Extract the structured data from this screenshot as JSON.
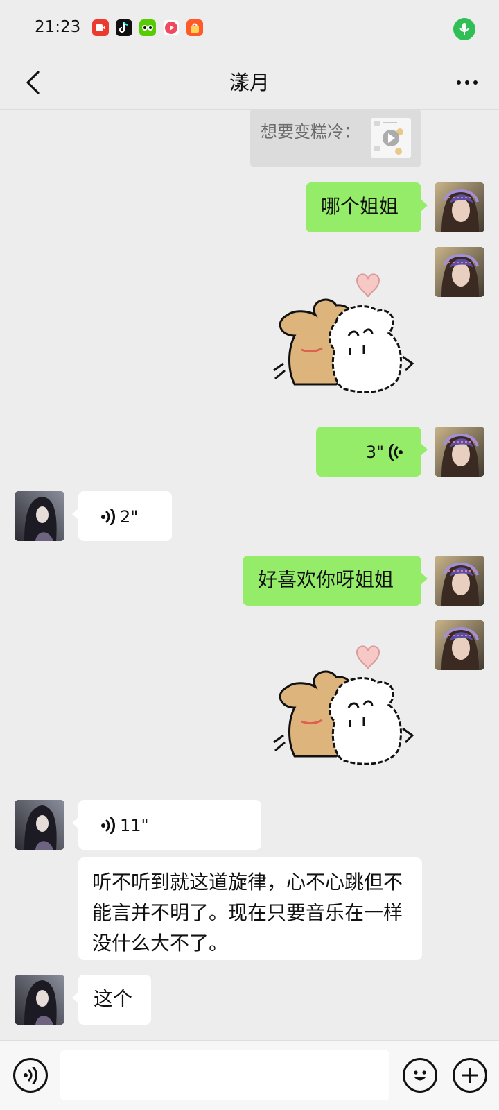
{
  "status_bar": {
    "time": "21:23",
    "app_icons": [
      {
        "name": "video-app-icon",
        "color": "#ec3a2f"
      },
      {
        "name": "tiktok-icon",
        "color": "#111111"
      },
      {
        "name": "duolingo-icon",
        "color": "#58cc02"
      },
      {
        "name": "player-app-icon",
        "color": "#f04a5d"
      },
      {
        "name": "shopping-app-icon",
        "color": "#ff5a2a"
      }
    ],
    "mic_indicator_color": "#2fbf55"
  },
  "header": {
    "title": "漾月"
  },
  "quoted_message": {
    "text": "想要变糕冷："
  },
  "messages": [
    {
      "id": "m1",
      "side": "me",
      "type": "text",
      "text": "哪个姐姐"
    },
    {
      "id": "m2",
      "side": "me",
      "type": "sticker",
      "sticker": "dog-hug-sticker"
    },
    {
      "id": "m3",
      "side": "me",
      "type": "voice",
      "duration": "3\""
    },
    {
      "id": "m4",
      "side": "other",
      "type": "voice",
      "duration": "2\""
    },
    {
      "id": "m5",
      "side": "me",
      "type": "text",
      "text": "好喜欢你呀姐姐"
    },
    {
      "id": "m6",
      "side": "me",
      "type": "sticker",
      "sticker": "dog-hug-sticker"
    },
    {
      "id": "m7",
      "side": "other",
      "type": "voice",
      "duration": "11\""
    },
    {
      "id": "m8",
      "side": "other",
      "type": "text",
      "text": "听不听到就这道旋律，心不心跳但不能言并不明了。现在只要音乐在一样没什么大不了。"
    },
    {
      "id": "m9",
      "side": "other",
      "type": "text",
      "text": "这个"
    }
  ],
  "input": {
    "placeholder": ""
  },
  "colors": {
    "background": "#ededed",
    "my_bubble": "#95ec69",
    "other_bubble": "#ffffff",
    "accent_green": "#2fbf55"
  }
}
